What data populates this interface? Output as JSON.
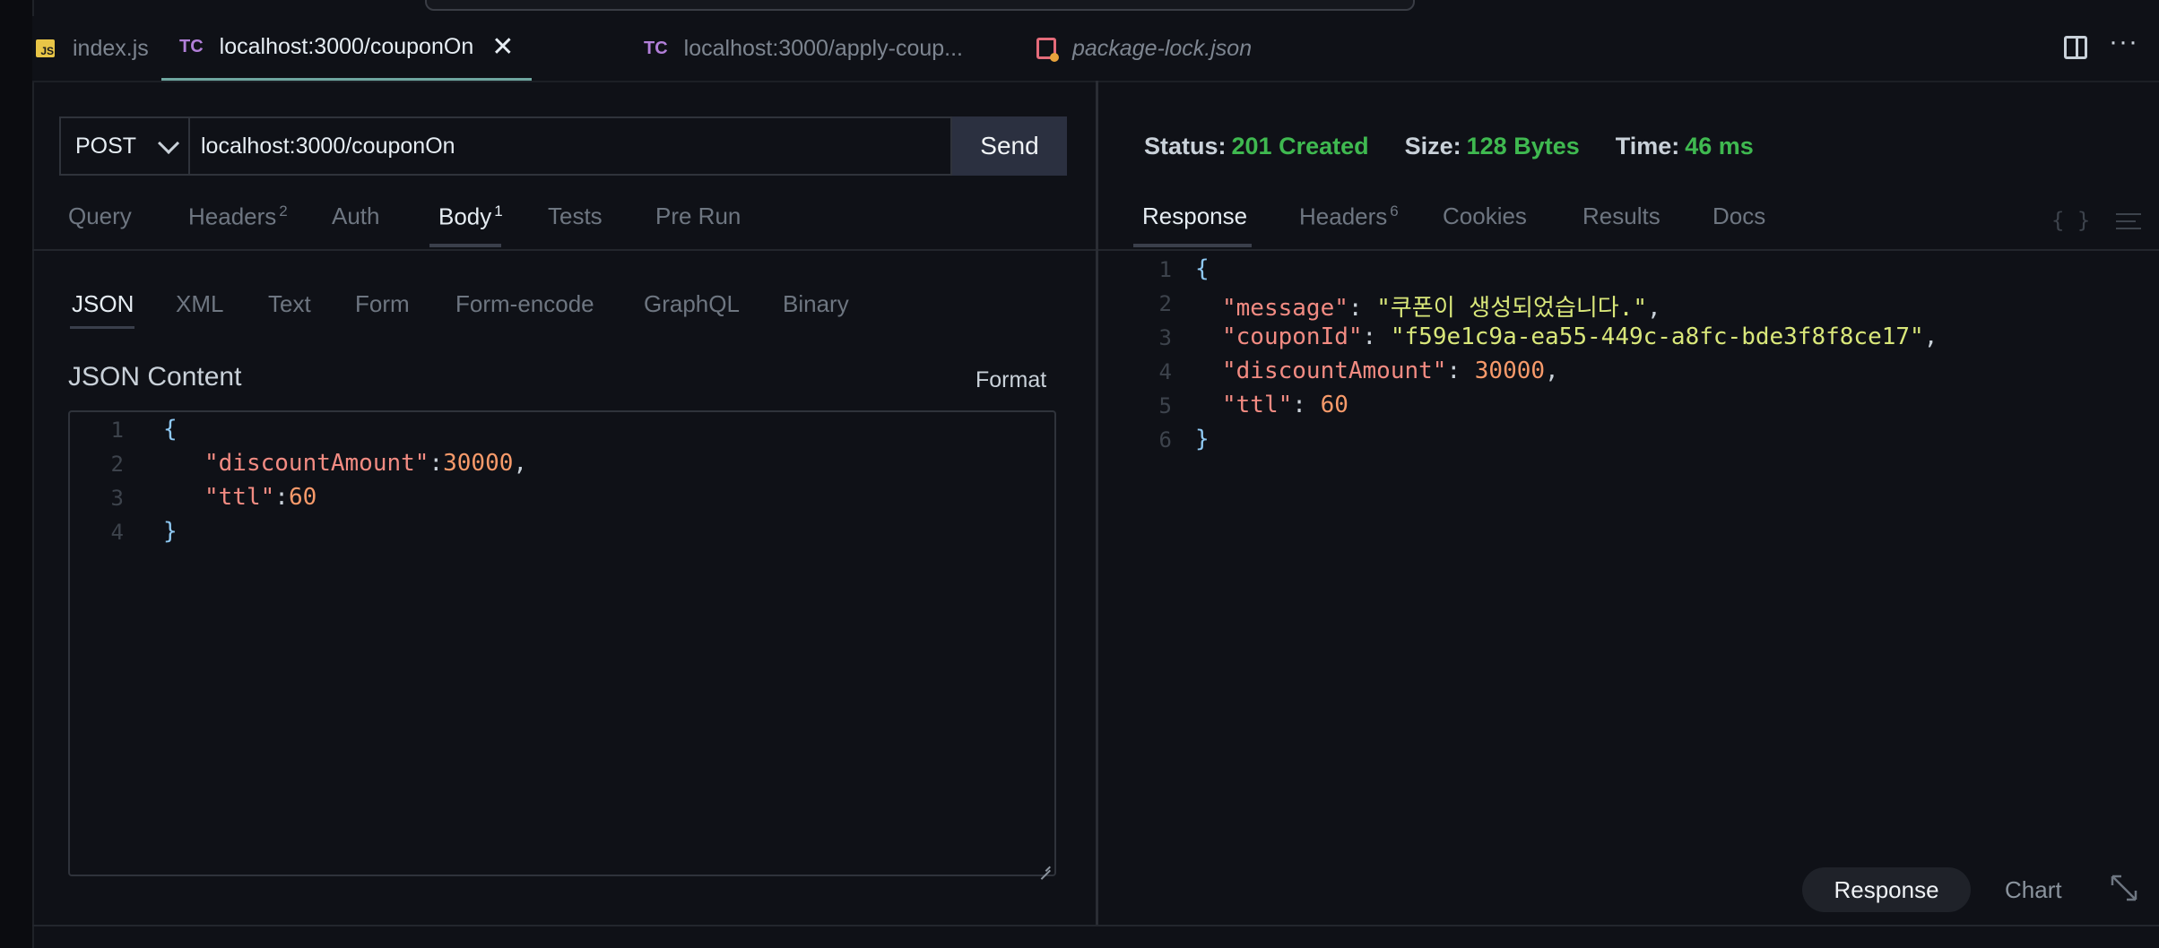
{
  "tabs": [
    {
      "icon": "js-icon",
      "icon_text": "JS",
      "label": "index.js"
    },
    {
      "icon": "tc-icon",
      "icon_text": "TC",
      "label": "localhost:3000/couponOn",
      "active": true
    },
    {
      "icon": "tc-icon",
      "icon_text": "TC",
      "label": "localhost:3000/apply-coup..."
    },
    {
      "icon": "package-json-icon",
      "label": "package-lock.json"
    }
  ],
  "request": {
    "method": "POST",
    "url": "localhost:3000/couponOn",
    "send_label": "Send",
    "tabs": [
      {
        "label": "Query"
      },
      {
        "label": "Headers",
        "badge": "2"
      },
      {
        "label": "Auth"
      },
      {
        "label": "Body",
        "badge": "1",
        "active": true
      },
      {
        "label": "Tests"
      },
      {
        "label": "Pre Run"
      }
    ],
    "body_tabs": [
      "JSON",
      "XML",
      "Text",
      "Form",
      "Form-encode",
      "GraphQL",
      "Binary"
    ],
    "json_title": "JSON Content",
    "format_label": "Format",
    "editor_lines": [
      "1",
      "2",
      "3",
      "4"
    ],
    "body": {
      "open": "{",
      "k1": "\"discountAmount\"",
      "v1": "30000",
      "k2": "\"ttl\"",
      "v2": "60",
      "close": "}"
    }
  },
  "response": {
    "status_label": "Status:",
    "status_value": "201 Created",
    "size_label": "Size:",
    "size_value": "128 Bytes",
    "time_label": "Time:",
    "time_value": "46 ms",
    "status_color": "#3fb950",
    "tabs": [
      {
        "label": "Response",
        "active": true
      },
      {
        "label": "Headers",
        "badge": "6"
      },
      {
        "label": "Cookies"
      },
      {
        "label": "Results"
      },
      {
        "label": "Docs"
      }
    ],
    "braces_icon": "{ }",
    "editor_lines": [
      "1",
      "2",
      "3",
      "4",
      "5",
      "6"
    ],
    "body": {
      "open": "{",
      "k1": "\"message\"",
      "v1": "\"쿠폰이 생성되었습니다.\"",
      "k2": "\"couponId\"",
      "v2": "\"f59e1c9a-ea55-449c-a8fc-bde3f8f8ce17\"",
      "k3": "\"discountAmount\"",
      "v3": "30000",
      "k4": "\"ttl\"",
      "v4": "60",
      "close": "}"
    },
    "bottom_response": "Response",
    "bottom_chart": "Chart"
  }
}
